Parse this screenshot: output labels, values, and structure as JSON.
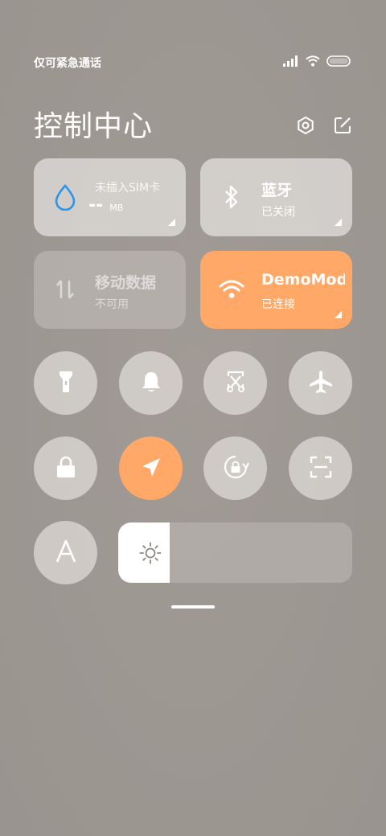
{
  "status_bar": {
    "carrier": "仅可紧急通话",
    "icons": [
      "signal-icon",
      "wifi-icon",
      "battery-icon"
    ]
  },
  "header": {
    "title": "控制中心",
    "actions": [
      "settings-icon",
      "edit-icon"
    ]
  },
  "tiles": {
    "data_usage": {
      "title": "未插入SIM卡",
      "value": "--",
      "unit": "MB",
      "icon": "droplet-icon"
    },
    "bluetooth": {
      "title": "蓝牙",
      "status": "已关闭",
      "icon": "bluetooth-icon"
    },
    "mobile_data": {
      "title": "移动数据",
      "status": "不可用",
      "icon": "data-arrows-icon"
    },
    "wifi": {
      "title": "DemoMode",
      "status": "已连接",
      "icon": "wifi-icon"
    }
  },
  "toggles": [
    {
      "name": "flashlight",
      "icon": "flashlight-icon",
      "active": false
    },
    {
      "name": "ringer",
      "icon": "bell-icon",
      "active": false
    },
    {
      "name": "screenshot",
      "icon": "scissors-icon",
      "active": false
    },
    {
      "name": "airplane-mode",
      "icon": "airplane-icon",
      "active": false
    },
    {
      "name": "lock-screen",
      "icon": "lock-icon",
      "active": false
    },
    {
      "name": "location",
      "icon": "location-arrow-icon",
      "active": true
    },
    {
      "name": "rotation-lock",
      "icon": "rotation-lock-icon",
      "active": false
    },
    {
      "name": "scanner",
      "icon": "scan-icon",
      "active": false
    },
    {
      "name": "font-size",
      "icon": "letter-a-icon",
      "active": false
    }
  ],
  "brightness": {
    "level": 0.22,
    "icon": "sun-icon"
  },
  "colors": {
    "accent": "#ffa868",
    "droplet": "#2a96e8",
    "tile_text_dim": "#ffffff"
  }
}
